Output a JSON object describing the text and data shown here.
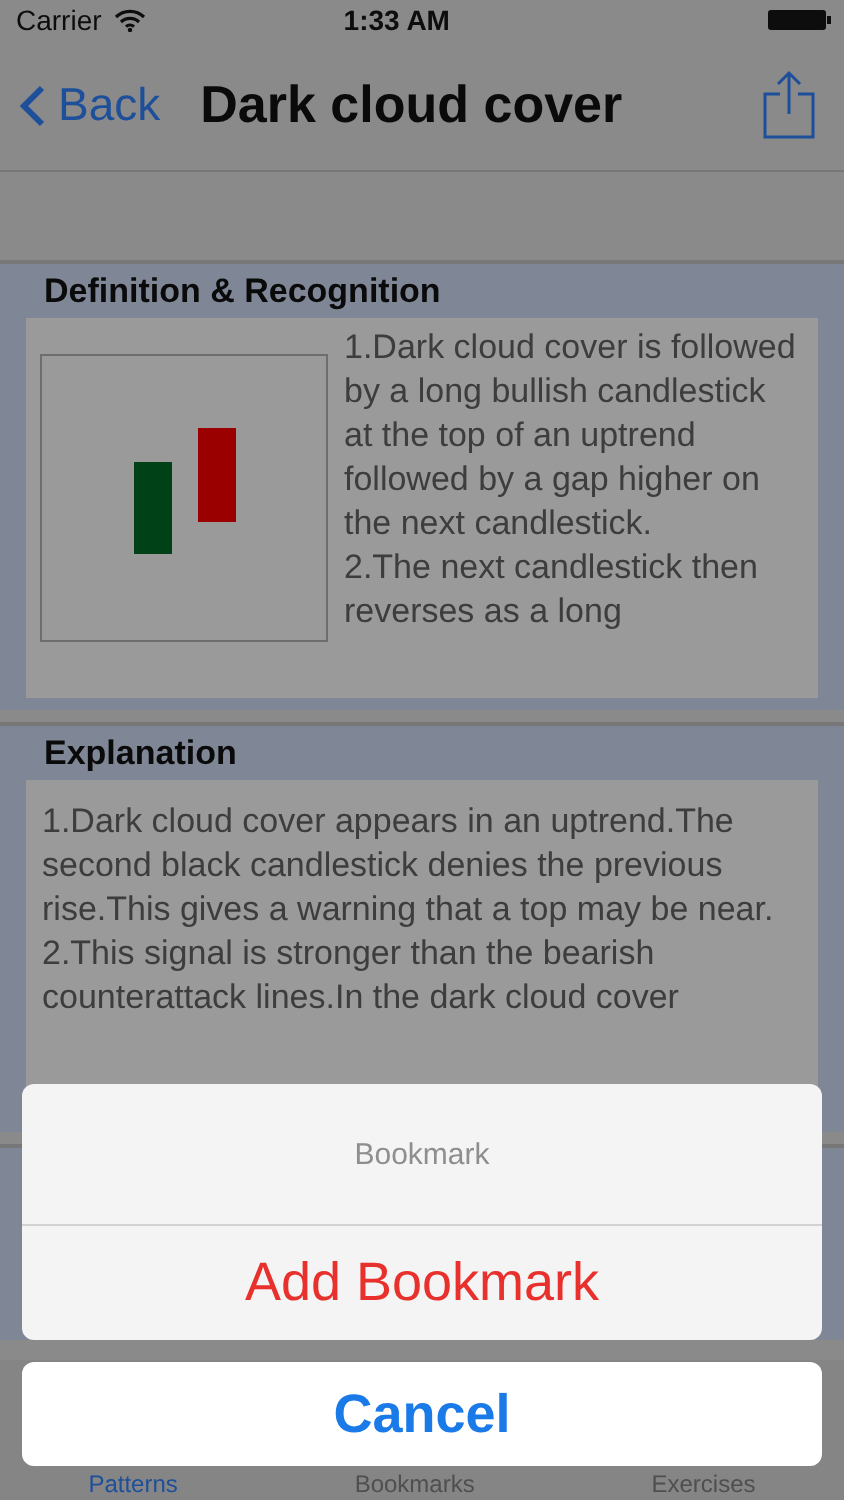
{
  "status_bar": {
    "carrier": "Carrier",
    "time": "1:33 AM"
  },
  "nav": {
    "back": "Back",
    "title": "Dark cloud cover"
  },
  "sections": [
    {
      "title": "Definition & Recognition",
      "kind": "figure",
      "text": "1.Dark cloud cover is followed by a long bullish candlestick at the top of an uptrend followed by a gap higher on the next candlestick.\n2.The next candlestick then reverses as a long"
    },
    {
      "title": "Explanation",
      "kind": "text",
      "text": "1.Dark cloud cover appears in an uptrend.The second black candlestick denies the previous rise.This gives a warning that a top may be near.\n2.This signal is stronger than the bearish counterattack lines.In the dark cloud cover"
    }
  ],
  "action_sheet": {
    "title": "Bookmark",
    "action": "Add Bookmark",
    "cancel": "Cancel"
  },
  "tabs": [
    {
      "label": "Patterns",
      "selected": true
    },
    {
      "label": "Bookmarks",
      "selected": false
    },
    {
      "label": "Exercises",
      "selected": false
    }
  ]
}
